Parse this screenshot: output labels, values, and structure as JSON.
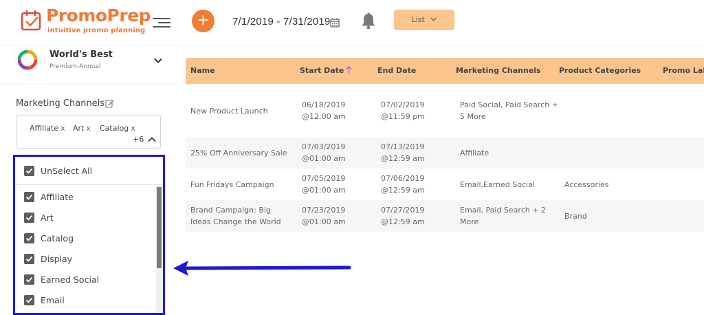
{
  "brand": {
    "name": "PromoPrep",
    "tagline": "intuitive promo planning",
    "accent": "#ee7a3b",
    "header_button_color": "#fdc58e",
    "dropdown_border_color": "#1b1bd0"
  },
  "header": {
    "add_label": "+",
    "date_range": "7/1/2019 - 7/31/2019",
    "view_button": "List",
    "icons": [
      "hamburger-icon",
      "calendar-icon",
      "bell-icon",
      "chevron-down-icon"
    ]
  },
  "account": {
    "name": "World's Best",
    "plan": "Premium-Annual"
  },
  "filter": {
    "label": "Marketing Channels",
    "chips": [
      "Affiliate",
      "Art",
      "Catalog"
    ],
    "chip_remove": "x",
    "more": "+6",
    "unselect_all": "UnSelect All",
    "options": [
      {
        "label": "Affiliate",
        "checked": true
      },
      {
        "label": "Art",
        "checked": true
      },
      {
        "label": "Catalog",
        "checked": true
      },
      {
        "label": "Display",
        "checked": true
      },
      {
        "label": "Earned Social",
        "checked": true
      },
      {
        "label": "Email",
        "checked": true
      }
    ]
  },
  "table": {
    "columns": [
      "Name",
      "Start Date",
      "End Date",
      "Marketing Channels",
      "Product Categories",
      "Promo Labe"
    ],
    "rows": [
      {
        "name": [
          "New Product Launch"
        ],
        "start": [
          "06/18/2019",
          "@12:00 am"
        ],
        "end": [
          "07/02/2019",
          "@11:59 pm"
        ],
        "channels": [
          "Paid Social, Paid Search +",
          "5 More"
        ],
        "categories": [
          ""
        ]
      },
      {
        "name": [
          "25% Off Anniversary Sale"
        ],
        "start": [
          "07/03/2019",
          "@01:00 am"
        ],
        "end": [
          "07/13/2019",
          "@12:59 am"
        ],
        "channels": [
          "Affiliate"
        ],
        "categories": [
          ""
        ]
      },
      {
        "name": [
          "Fun Fridays Campaign"
        ],
        "start": [
          "07/05/2019",
          "@01:00 am"
        ],
        "end": [
          "07/06/2019",
          "@12:59 am"
        ],
        "channels": [
          "Email,Earned Social"
        ],
        "categories": [
          "Accessories"
        ]
      },
      {
        "name": [
          "Brand Campaign: Big",
          "Ideas Change the World"
        ],
        "start": [
          "07/23/2019",
          "@01:00 am"
        ],
        "end": [
          "07/27/2019",
          "@12:59 am"
        ],
        "channels": [
          "Email, Paid Search + 2",
          "More"
        ],
        "categories": [
          "Brand"
        ]
      }
    ]
  }
}
